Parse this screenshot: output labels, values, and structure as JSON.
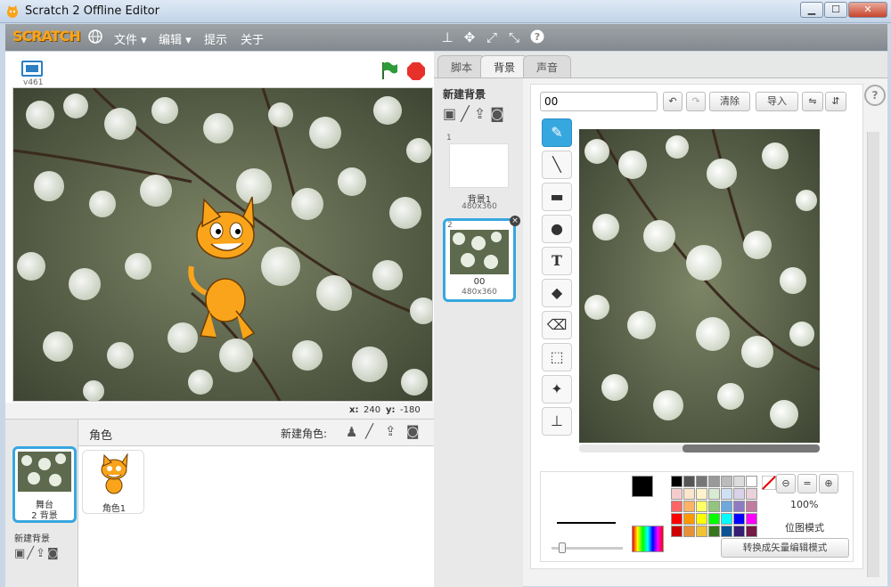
{
  "window": {
    "title": "Scratch 2 Offline Editor",
    "min": "▁",
    "max": "☐",
    "close": "✕"
  },
  "menubar": {
    "logo": "SCRATCH",
    "menus": [
      "文件 ▾",
      "编辑 ▾",
      "提示",
      "关于"
    ]
  },
  "stage": {
    "version": "v461",
    "coords_x_label": "x:",
    "coords_x": "240",
    "coords_y_label": "y:",
    "coords_y": "-180"
  },
  "sprites": {
    "header_label": "角色",
    "new_sprite_label": "新建角色:",
    "stage_item_name": "舞台",
    "stage_item_sub": "2 背景",
    "new_backdrop_label": "新建背景",
    "items": [
      {
        "name": "角色1"
      }
    ]
  },
  "tabs": [
    "脚本",
    "背景",
    "声音"
  ],
  "backdrops": {
    "new_label": "新建背景",
    "items": [
      {
        "index": "1",
        "name": "背景1",
        "size": "480x360"
      },
      {
        "index": "2",
        "name": "00",
        "size": "480x360"
      }
    ]
  },
  "editor": {
    "name_value": "00",
    "clear": "清除",
    "import_label": "导入",
    "zoom": "100%",
    "mode_label": "位图模式",
    "convert_label": "转换成矢量编辑模式"
  },
  "palette": [
    "#000000",
    "#555555",
    "#777777",
    "#999999",
    "#bbbbbb",
    "#dddddd",
    "#ffffff",
    "#f4cccc",
    "#fce5cd",
    "#fff2cc",
    "#d9ead3",
    "#cfe2f3",
    "#d9d2e9",
    "#ead1dc",
    "#ff6666",
    "#ffb366",
    "#ffff66",
    "#93c47d",
    "#6fa8dc",
    "#8e7cc3",
    "#c27ba0",
    "#ff0000",
    "#ff9900",
    "#ffff00",
    "#00ff00",
    "#00ffff",
    "#0000ff",
    "#ff00ff",
    "#cc0000",
    "#e69138",
    "#f1c232",
    "#38761d",
    "#0b5394",
    "#351c75",
    "#741b47"
  ],
  "colors": {
    "accent": "#37a7e0",
    "logo": "#f9a41a",
    "stop": "#e8302a",
    "flag": "#2f9a3a"
  }
}
